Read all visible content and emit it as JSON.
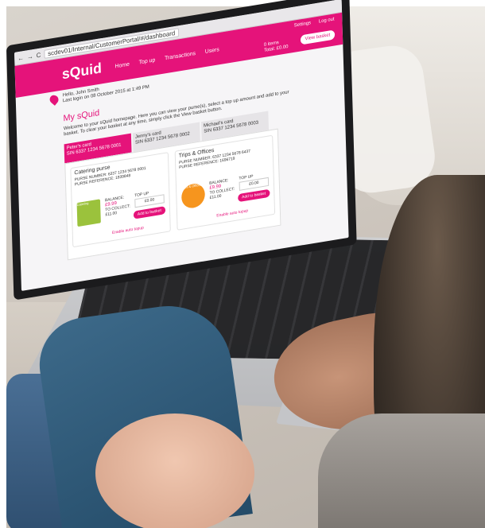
{
  "browser": {
    "url": "scdev01/Internal/CustomerPortal/#/dashboard"
  },
  "app": {
    "brand_color": "#e5137a",
    "logo": "sQuid",
    "nav": [
      "Home",
      "Top up",
      "Transactions",
      "Users"
    ],
    "settings_label": "Settings",
    "logout_label": "Log out",
    "basket_items": "0 items",
    "basket_total": "Total: £0.00",
    "view_basket_label": "View basket",
    "greeting": "Hello, John Smith",
    "last_login": "Last login on 08 October 2015 at 1:49 PM",
    "page_title": "My sQuid",
    "intro": "Welcome to your sQuid homepage. Here you can view your purse(s), select a top up amount and add to your basket. To clear your basket at any time, simply click the View basket button."
  },
  "cards": [
    {
      "name": "Peter's card",
      "number": "SIN 6337 1234 5678 0001",
      "active": true
    },
    {
      "name": "Jenny's card",
      "number": "SIN 6337 1234 5678 0002",
      "active": false
    },
    {
      "name": "Michael's card",
      "number": "SIN 6337 1234 5678 0003",
      "active": false
    }
  ],
  "purses": [
    {
      "title": "Catering purse",
      "purse_number": "PURSE NUMBER: 6337 1234 5678 0001",
      "purse_reference": "PURSE REFERENCE: 1839848",
      "balance_label": "BALANCE:",
      "balance": "£9.99",
      "to_collect_label": "TO COLLECT:",
      "to_collect": "£11.00",
      "topup_label": "TOP UP",
      "topup_value": "£0.00",
      "add_label": "Add to basket",
      "auto_label": "Enable auto topup",
      "image_label": "Catering"
    },
    {
      "title": "Trips & Offices",
      "purse_number": "PURSE NUMBER: 6337 1234 5678 6437",
      "purse_reference": "PURSE REFERENCE: 1696719",
      "balance_label": "BALANCE:",
      "balance": "£9.99",
      "to_collect_label": "TO COLLECT:",
      "to_collect": "£11.00",
      "topup_label": "TOP UP",
      "topup_value": "£0.00",
      "add_label": "Add to basket",
      "auto_label": "Enable auto topup",
      "image_label": "Trips & Offices"
    }
  ]
}
